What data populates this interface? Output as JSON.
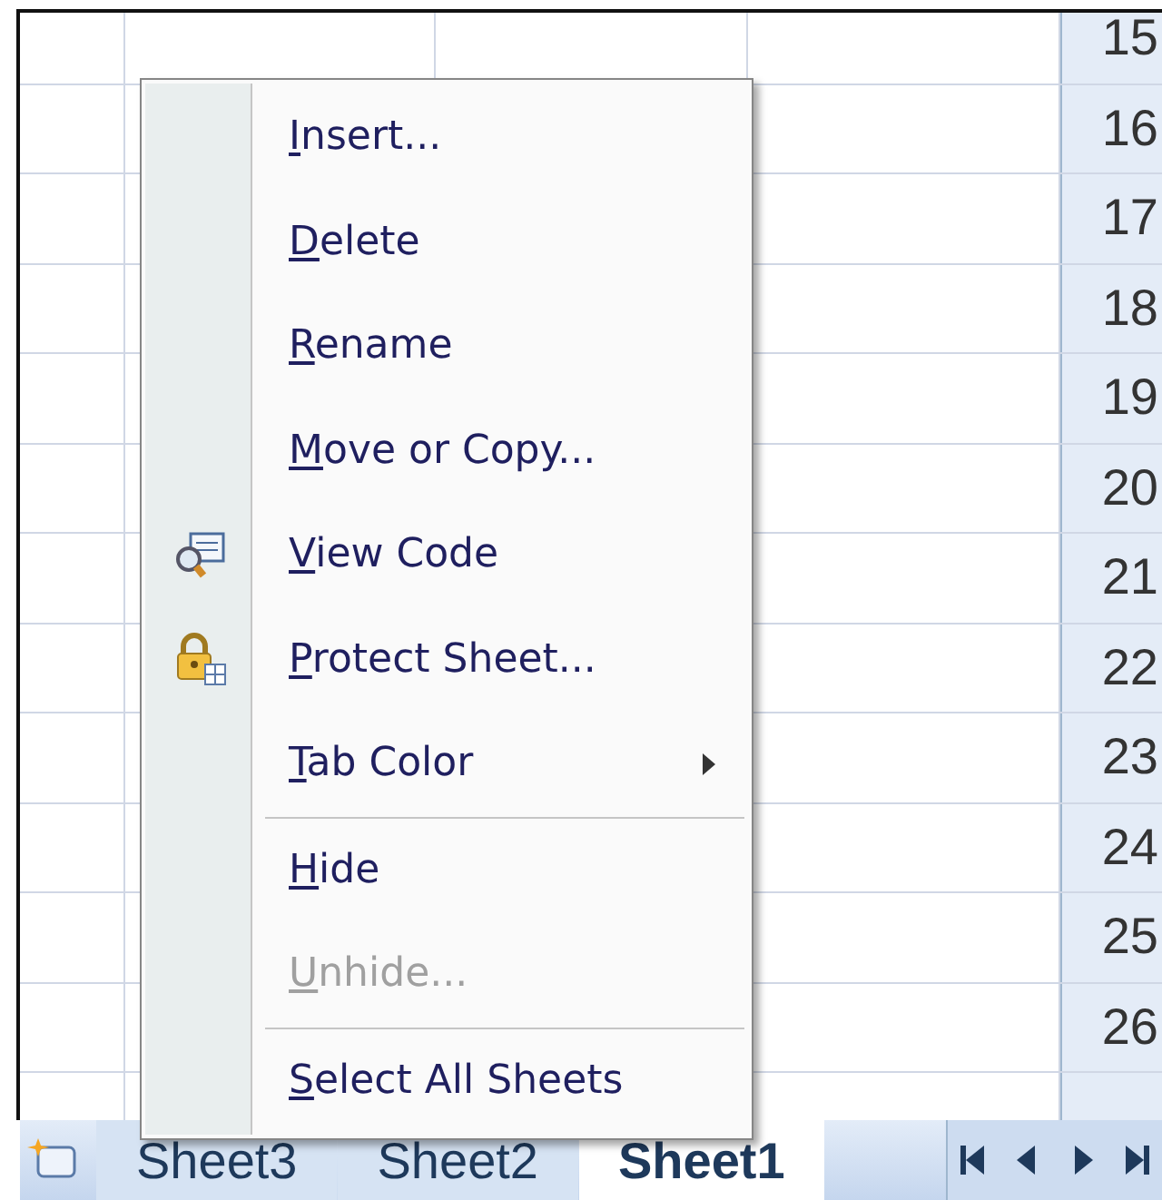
{
  "row_headers": [
    "15",
    "16",
    "17",
    "18",
    "19",
    "20",
    "21",
    "22",
    "23",
    "24",
    "25",
    "26"
  ],
  "context_menu": {
    "items": [
      {
        "kind": "plain",
        "label": "Insert...",
        "disabled": false
      },
      {
        "kind": "plain",
        "label": "Delete",
        "disabled": false
      },
      {
        "kind": "plain",
        "label": "Rename",
        "disabled": false
      },
      {
        "kind": "plain",
        "label": "Move or Copy...",
        "disabled": false
      },
      {
        "kind": "code",
        "label": "View Code",
        "disabled": false
      },
      {
        "kind": "lock",
        "label": "Protect Sheet...",
        "disabled": false
      },
      {
        "kind": "submenu",
        "label": "Tab Color",
        "disabled": false
      },
      {
        "kind": "separator"
      },
      {
        "kind": "plain",
        "label": "Hide",
        "disabled": false
      },
      {
        "kind": "plain",
        "label": "Unhide...",
        "disabled": true
      },
      {
        "kind": "separator"
      },
      {
        "kind": "plain",
        "label": "Select All Sheets",
        "disabled": false
      }
    ]
  },
  "sheet_tabs": [
    {
      "label": "Sheet3",
      "selected": false
    },
    {
      "label": "Sheet2",
      "selected": false
    },
    {
      "label": "Sheet1",
      "selected": true
    }
  ]
}
